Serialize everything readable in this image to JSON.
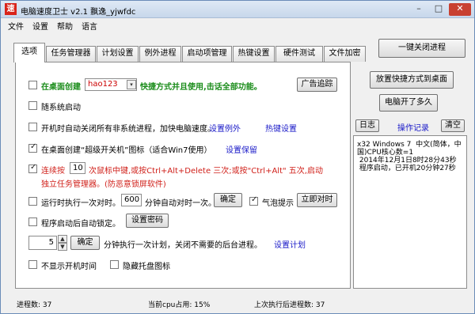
{
  "window": {
    "title": "电脑速度卫士 v2.1 飘逸_yjwfdc",
    "icon_text": "速",
    "minimize": "–",
    "maximize": "□",
    "close": "✕"
  },
  "menu": [
    "文件",
    "设置",
    "帮助",
    "语言"
  ],
  "top_button": "一键关闭进程",
  "tabs": [
    "选项",
    "任务管理器",
    "计划设置",
    "例外进程",
    "启动项管理",
    "热键设置",
    "硬件测试",
    "文件加密"
  ],
  "options": {
    "row1_prefix": "在桌面创建",
    "row1_select": "hao123",
    "row1_suffix": "快捷方式并且使用,击话全部功能。",
    "row1_button": "广告追踪",
    "row2": "随系统启动",
    "row3": "开机时自动关闭所有非系统进程，加快电脑速度。",
    "row3_link1": "设置例外",
    "row3_link2": "热键设置",
    "row4": "在桌面创建“超级开关机”图标（适合Win7使用）",
    "row4_link": "设置保留",
    "row5_prefix": "连续按",
    "row5_value": "10",
    "row5_text": "次鼠标中键,或按Ctrl+Alt+Delete 三次;或按\"Ctrl+Alt\" 五次,启动",
    "row5_text2": "独立任务管理器。(防恶意锁屏软件)",
    "row6_prefix": "运行时执行一次对时。",
    "row6_value": "600",
    "row6_suffix": "分钟自动对时一次。",
    "row6_button": "确定",
    "row6_check": "气泡提示",
    "row6_button2": "立即对时",
    "row7": "程序启动后自动锁定。",
    "row7_button": "设置密码",
    "row8_value": "5",
    "row8_button": "确定",
    "row8_text": "分钟执行一次计划，关闭不需要的后台进程。",
    "row8_link": "设置计划",
    "row9": "不显示开机时间",
    "row9b": "隐藏托盘图标"
  },
  "right": {
    "btn1": "放置快捷方式到桌面",
    "btn2": "电脑开了多久",
    "log_btn": "日志",
    "log_label": "操作记录",
    "clear_btn": "清空",
    "log_text": "x32 Windows 7  中文(简体，中国)CPU核心数=1\n 2014年12月1日8时28分43秒\n 程序启动，已开机20分钟27秒"
  },
  "status": {
    "proc": "进程数: 37",
    "cpu": "当前cpu占用: 15%",
    "last": "上次执行后进程数: 37"
  }
}
